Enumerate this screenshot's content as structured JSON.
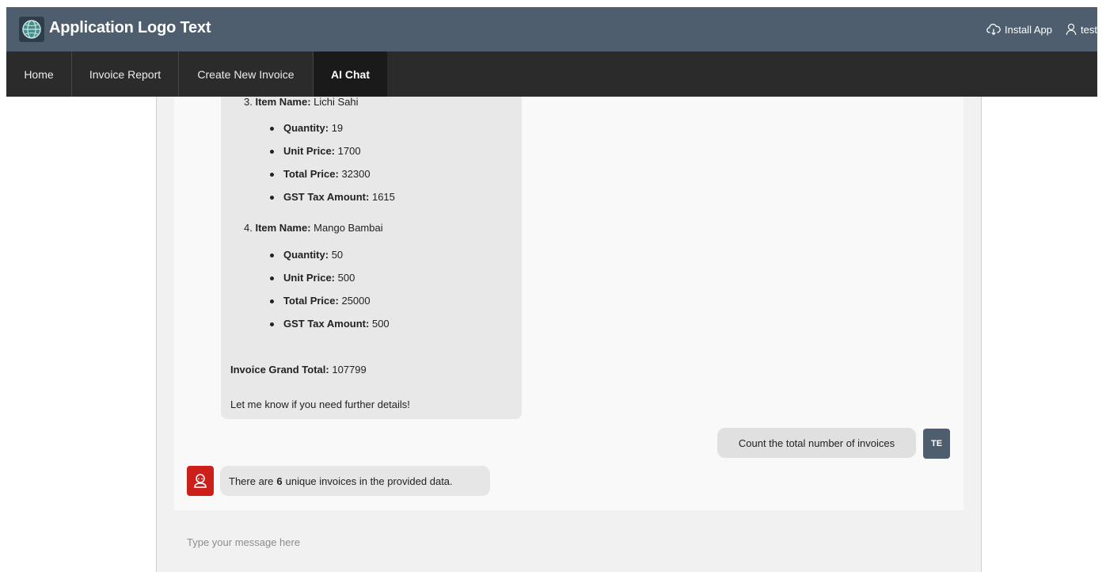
{
  "header": {
    "app_title": "Application Logo Text",
    "install_label": "Install App",
    "user_label": "test"
  },
  "nav": {
    "items": [
      {
        "label": "Home",
        "active": false
      },
      {
        "label": "Invoice Report",
        "active": false
      },
      {
        "label": "Create New Invoice",
        "active": false
      },
      {
        "label": "AI Chat",
        "active": true
      }
    ]
  },
  "chat": {
    "bot_message_1": {
      "items": [
        {
          "number": "3.",
          "name_label": "Item Name:",
          "name": "Lichi Sahi",
          "details": [
            {
              "label": "Quantity:",
              "value": "19"
            },
            {
              "label": "Unit Price:",
              "value": "1700"
            },
            {
              "label": "Total Price:",
              "value": "32300"
            },
            {
              "label": "GST Tax Amount:",
              "value": "1615"
            }
          ]
        },
        {
          "number": "4.",
          "name_label": "Item Name:",
          "name": "Mango Bambai",
          "details": [
            {
              "label": "Quantity:",
              "value": "50"
            },
            {
              "label": "Unit Price:",
              "value": "500"
            },
            {
              "label": "Total Price:",
              "value": "25000"
            },
            {
              "label": "GST Tax Amount:",
              "value": "500"
            }
          ]
        }
      ],
      "grand_total_label": "Invoice Grand Total:",
      "grand_total_value": "107799",
      "closing": "Let me know if you need further details!"
    },
    "user_message": "Count the total number of invoices",
    "user_initials": "TE",
    "bot_message_2": {
      "prefix": "There are",
      "count": "6",
      "suffix": "unique invoices in the provided data."
    },
    "input_placeholder": "Type your message here"
  },
  "colors": {
    "header_bg": "#4e5e6e",
    "nav_bg": "#2b2b2b",
    "nav_active_bg": "#1a1a1a",
    "bot_avatar": "#cc1f1a",
    "bubble_bg": "#e8e8e8"
  },
  "icons": {
    "logo": "globe-logo-icon",
    "install": "cloud-download-icon",
    "user": "user-icon",
    "bot": "bot-icon"
  }
}
